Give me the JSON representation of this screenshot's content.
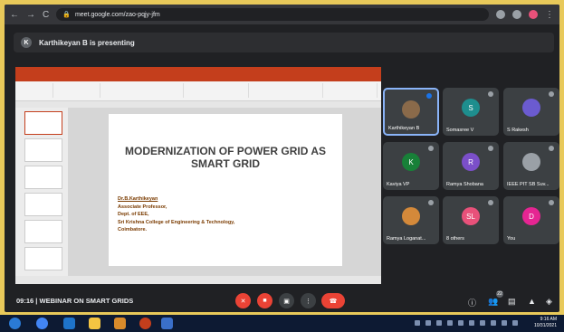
{
  "browser": {
    "url": "meet.google.com/zao-pqjy-jfm"
  },
  "banner": {
    "initial": "K",
    "text": "Karthikeyan B is presenting"
  },
  "slide": {
    "title": "MODERNIZATION OF POWER GRID AS SMART GRID",
    "presenter_lines": [
      "Dr.B.Karthikeyan",
      "Associate Professor,",
      "Dept. of EEE,",
      "Sri Krishna College of Engineering & Technology,",
      "Coimbatore."
    ]
  },
  "participants": [
    {
      "name": "Karthikeyan B",
      "initial": "",
      "color": "#8a6a4a",
      "photo": true
    },
    {
      "name": "Somasree V",
      "initial": "S",
      "color": "#1e8e8e"
    },
    {
      "name": "S Rakesh",
      "initial": "",
      "color": "#6b5bd0",
      "photo": true
    },
    {
      "name": "Kaviya VP",
      "initial": "K",
      "color": "#188038"
    },
    {
      "name": "Ramya Shobana",
      "initial": "R",
      "color": "#7b4fc9"
    },
    {
      "name": "IEEE PIT SB Suv...",
      "initial": "",
      "color": "#9aa0a6",
      "photo": true
    },
    {
      "name": "Ramya Loganat...",
      "initial": "",
      "color": "#d4893a",
      "photo": true
    },
    {
      "name": "8 others",
      "initial": "SL",
      "color": "#e8517a"
    },
    {
      "name": "You",
      "initial": "D",
      "color": "#e52592"
    }
  ],
  "bottom": {
    "time": "09:16",
    "separator": "|",
    "meeting_name": "WEBINAR ON SMART GRIDS",
    "participant_count": "22"
  },
  "taskbar": {
    "time": "9:16 AM",
    "date": "10/31/2021"
  }
}
